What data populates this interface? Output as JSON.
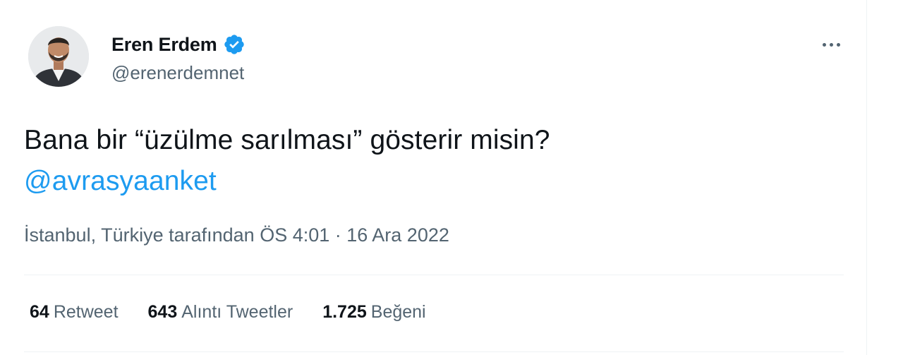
{
  "author": {
    "display_name": "Eren Erdem",
    "handle": "@erenerdemnet",
    "verified": true,
    "verified_icon": "verified-badge-icon",
    "avatar_icon": "profile-photo"
  },
  "tweet": {
    "text": "Bana bir “üzülme sarılması” gösterir misin?",
    "mention": "@avrasyaanket",
    "meta": "İstanbul, Türkiye tarafından ÖS 4:01 · 16 Ara 2022"
  },
  "stats": {
    "retweets": {
      "count": "64",
      "label": "Retweet"
    },
    "quotes": {
      "count": "643",
      "label": "Alıntı Tweetler"
    },
    "likes": {
      "count": "1.725",
      "label": "Beğeni"
    }
  },
  "colors": {
    "accent": "#1d9bf0",
    "secondary_text": "#536471",
    "primary_text": "#0f1419",
    "divider": "#eff3f4"
  }
}
